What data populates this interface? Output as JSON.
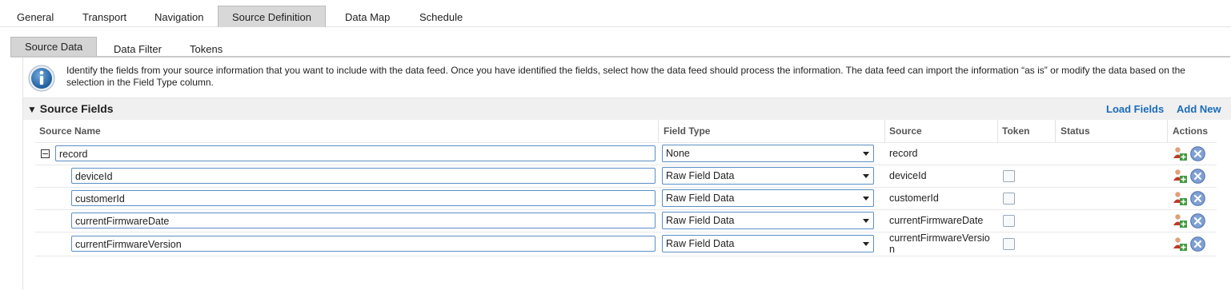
{
  "top_tabs": [
    "General",
    "Transport",
    "Navigation",
    "Source Definition",
    "Data Map",
    "Schedule"
  ],
  "active_top_tab": "Source Definition",
  "sub_tabs": [
    "Source Data",
    "Data Filter",
    "Tokens"
  ],
  "active_sub_tab": "Source Data",
  "info": {
    "text": "Identify the fields from your source information that you want to include with the data feed. Once you have identified the fields, select how the data feed should process the information. The data feed can import the information “as is” or modify the data based on the selection in the Field Type column."
  },
  "section": {
    "toggle": "▼",
    "title": "Source Fields",
    "load_fields": "Load Fields",
    "add_new": "Add New"
  },
  "columns": {
    "source_name": "Source Name",
    "field_type": "Field Type",
    "source": "Source",
    "token": "Token",
    "status": "Status",
    "actions": "Actions"
  },
  "rows": [
    {
      "name": "record",
      "field_type": "None",
      "source": "record",
      "token_visible": false
    },
    {
      "name": "deviceId",
      "field_type": "Raw Field Data",
      "source": "deviceId",
      "token_visible": true
    },
    {
      "name": "customerId",
      "field_type": "Raw Field Data",
      "source": "customerId",
      "token_visible": true
    },
    {
      "name": "currentFirmwareDate",
      "field_type": "Raw Field Data",
      "source": "currentFirmwareDate",
      "token_visible": true
    },
    {
      "name": "currentFirmwareVersion",
      "field_type": "Raw Field Data",
      "source_line1": "currentFirmwareVersio",
      "source_line2": "n",
      "token_visible": true
    }
  ],
  "colors": {
    "link": "#1a6bb8",
    "input_border": "#5b8fc6",
    "active_tab_bg": "#d8d8d8"
  },
  "icons": {
    "info": "info-icon",
    "add_user": "add-user-icon",
    "delete": "delete-circle-icon",
    "collapse": "collapse-minus-icon",
    "dropdown": "chevron-down-icon"
  }
}
